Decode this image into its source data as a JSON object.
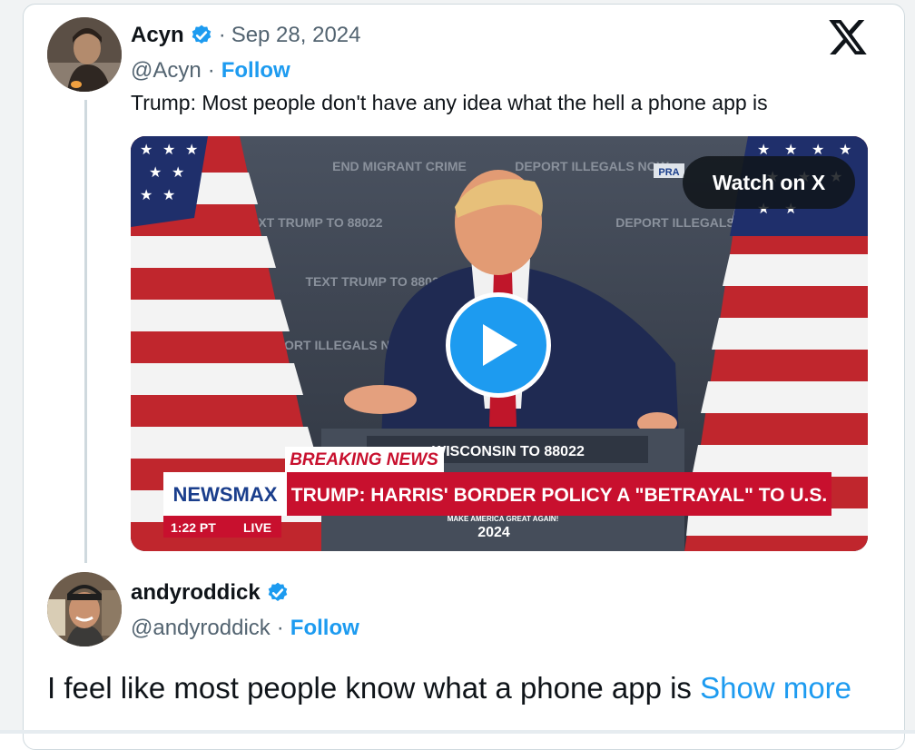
{
  "tweet": {
    "display_name": "Acyn",
    "date_separator": "·",
    "date": "Sep 28, 2024",
    "handle": "@Acyn",
    "handle_separator": "·",
    "follow_label": "Follow",
    "text": "Trump: Most people don't have any idea what the hell a phone app is",
    "verified_icon": "verified-badge-icon",
    "watch_label": "Watch on X",
    "video": {
      "banner_signs": [
        "END MIGRANT CRIME",
        "DEPORT ILLEGALS NOW",
        "TEXT TRUMP TO 88022",
        "DEPORT ILLEGALS",
        "TEXT TRUMP TO 88022",
        "DEPORT ILLEGALS NOW",
        "PRA"
      ],
      "podium_top": "WISCONSIN TO 88022",
      "breaking_news": "BREAKING NEWS",
      "network": "NEWSMAX",
      "headline": "TRUMP: HARRIS' BORDER POLICY A \"BETRAYAL\" TO U.S.",
      "time": "1:22 PT",
      "live": "LIVE",
      "podium_tagline": "MAKE AMERICA GREAT AGAIN!",
      "podium_year": "2024"
    }
  },
  "reply": {
    "display_name": "andyroddick",
    "handle": "@andyroddick",
    "handle_separator": "·",
    "follow_label": "Follow",
    "text": "I feel like most people know what a phone app is ",
    "show_more_label": "Show more"
  },
  "colors": {
    "accent": "#1d9bf0",
    "text_primary": "#0f1419",
    "text_secondary": "#536471",
    "newsmax_red": "#c8102e",
    "newsmax_blue": "#1a3e8c"
  }
}
